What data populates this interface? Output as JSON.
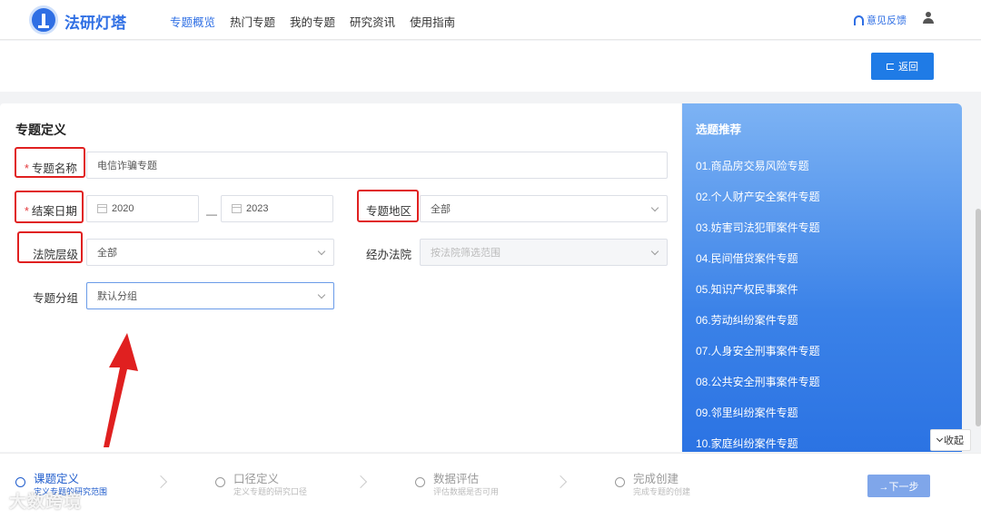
{
  "brand": {
    "name": "法研灯塔"
  },
  "nav": [
    {
      "label": "专题概览",
      "active": true
    },
    {
      "label": "热门专题",
      "active": false
    },
    {
      "label": "我的专题",
      "active": false
    },
    {
      "label": "研究资讯",
      "active": false
    },
    {
      "label": "使用指南",
      "active": false
    }
  ],
  "header": {
    "feedback_label": "意见反馈",
    "back_label": "返回"
  },
  "form": {
    "title": "专题定义",
    "topic_name": {
      "label": "专题名称",
      "value": "电信诈骗专题",
      "required": true
    },
    "close_date": {
      "label": "结案日期",
      "from": "2020",
      "to": "2023",
      "separator": "—",
      "required": true
    },
    "region": {
      "label": "专题地区",
      "value": "全部"
    },
    "court_level": {
      "label": "法院层级",
      "value": "全部"
    },
    "court": {
      "label": "经办法院",
      "placeholder": "按法院筛选范围"
    },
    "group": {
      "label": "专题分组",
      "value": "默认分组"
    }
  },
  "recommend": {
    "title": "选题推荐",
    "items": [
      "01.商品房交易风险专题",
      "02.个人财产安全案件专题",
      "03.妨害司法犯罪案件专题",
      "04.民间借贷案件专题",
      "05.知识产权民事案件",
      "06.劳动纠纷案件专题",
      "07.人身安全刑事案件专题",
      "08.公共安全刑事案件专题",
      "09.邻里纠纷案件专题",
      "10.家庭纠纷案件专题"
    ],
    "collapse_label": "收起"
  },
  "steps": [
    {
      "title": "课题定义",
      "sub": "定义专题的研究范围",
      "active": true
    },
    {
      "title": "口径定义",
      "sub": "定义专题的研究口径",
      "active": false
    },
    {
      "title": "数据评估",
      "sub": "评估数据是否可用",
      "active": false
    },
    {
      "title": "完成创建",
      "sub": "完成专题的创建",
      "active": false
    }
  ],
  "next_label": "→下一步",
  "watermark": "大数跨境",
  "colors": {
    "primary": "#1f7be6",
    "annotation": "#e02020",
    "recommend_panel": "#3b82e8"
  }
}
